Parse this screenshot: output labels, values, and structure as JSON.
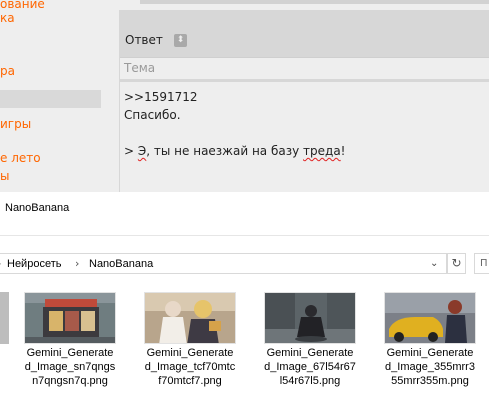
{
  "sidebar": {
    "links": [
      "ование",
      "ка",
      "ра",
      "игры",
      "е лето",
      "ы"
    ]
  },
  "post_form": {
    "answer_label": "Ответ",
    "subject_placeholder": "Тема",
    "comment": {
      "line1": ">>1591712",
      "line2": "Спасибо.",
      "line3_prefix": "> ",
      "line3_word1": "Э",
      "line3_mid": ", ты не наезжай на базу ",
      "line3_word2": "треда",
      "line3_suffix": "!"
    }
  },
  "file_dialog": {
    "title": "NanoBanana",
    "breadcrumb": [
      "Нейросеть",
      "NanoBanana"
    ],
    "files": [
      {
        "name": "Gemini_Generated_Image_sn7qngsn7qngsn7q.png",
        "scene": "shop-storefront"
      },
      {
        "name": "Gemini_Generated_Image_tcf70mtcf70mtcf7.png",
        "scene": "two-anime-girls"
      },
      {
        "name": "Gemini_Generated_Image_67l54r67l54r67l5.png",
        "scene": "rainy-street-figure"
      },
      {
        "name": "Gemini_Generated_Image_355mrr355mrr355m.png",
        "scene": "yellow-car-character"
      }
    ]
  },
  "colors": {
    "link": "#ff6600",
    "form_bg": "#d7d7d7",
    "page_bg": "#eeeeee"
  }
}
